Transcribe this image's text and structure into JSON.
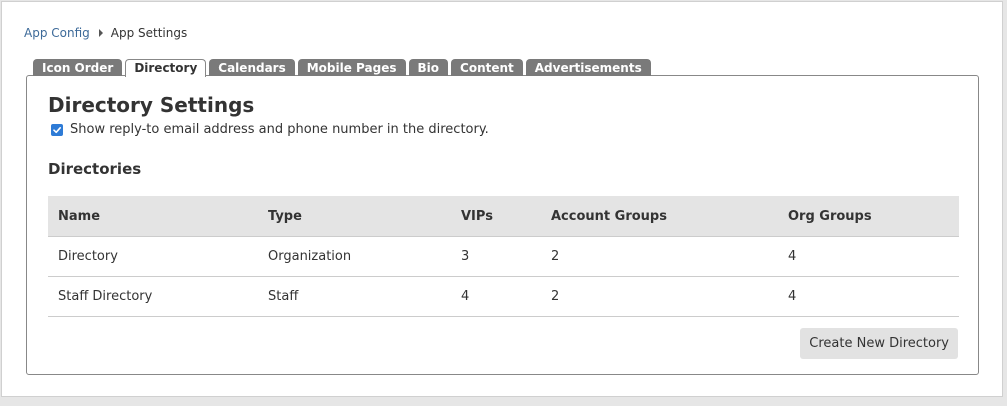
{
  "breadcrumb": {
    "parent": "App Config",
    "current": "App Settings"
  },
  "tabs": [
    {
      "label": "Icon Order",
      "active": false
    },
    {
      "label": "Directory",
      "active": true
    },
    {
      "label": "Calendars",
      "active": false
    },
    {
      "label": "Mobile Pages",
      "active": false
    },
    {
      "label": "Bio",
      "active": false
    },
    {
      "label": "Content",
      "active": false
    },
    {
      "label": "Advertisements",
      "active": false
    }
  ],
  "panel": {
    "title": "Directory Settings",
    "option_label": "Show reply-to email address and phone number in the directory.",
    "option_checked": true,
    "section_title": "Directories"
  },
  "table": {
    "headers": [
      "Name",
      "Type",
      "VIPs",
      "Account Groups",
      "Org Groups"
    ],
    "rows": [
      [
        "Directory",
        "Organization",
        "3",
        "2",
        "4"
      ],
      [
        "Staff Directory",
        "Staff",
        "4",
        "2",
        "4"
      ]
    ]
  },
  "actions": {
    "create_label": "Create New Directory"
  },
  "colors": {
    "accent": "#2e7bd6",
    "tab_bg": "#7a7a7a",
    "link": "#3d6a99"
  }
}
